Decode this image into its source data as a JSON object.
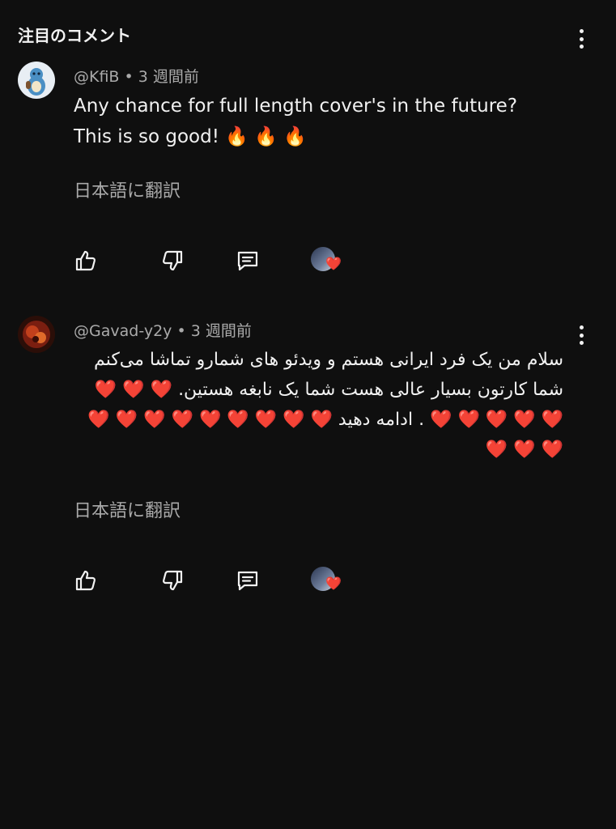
{
  "header": {
    "title": "注目のコメント"
  },
  "comments": [
    {
      "author": "@KfiB",
      "time": "3 週間前",
      "text_line1": "Any chance for full length cover's in the future?",
      "text_line2": "This is so good! 🔥 🔥 🔥",
      "translate_label": "日本語に翻訳"
    },
    {
      "author": "@Gavad-y2y",
      "time": "3 週間前",
      "text": "سلام من یک فرد ایرانی هستم و ویدئو های شمارو تماشا می‌کنم شما کارتون بسیار عالی هست شما یک نابغه هستین. ❤️ ❤️ ❤️ ❤️ ❤️ ❤️ ❤️ ❤️ .  ادامه دهید ❤️ ❤️ ❤️ ❤️ ❤️ ❤️ ❤️ ❤️ ❤️ ❤️ ❤️ ❤️",
      "translate_label": "日本語に翻訳"
    }
  ],
  "separator": "•",
  "creator_heart": "❤️",
  "icons": [
    "like-icon",
    "dislike-icon",
    "reply-icon",
    "creator-heart-icon",
    "more-vert-icon"
  ]
}
